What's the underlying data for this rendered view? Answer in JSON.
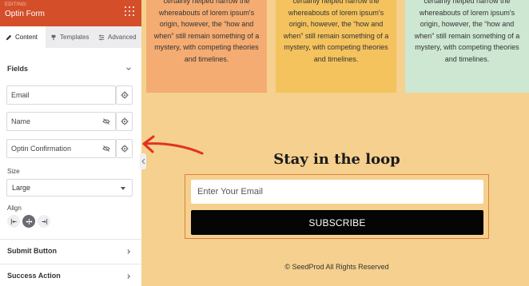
{
  "sidebar": {
    "editing_label": "EDITING:",
    "title": "Optin Form",
    "tabs": [
      {
        "label": "Content",
        "icon": "pencil-icon",
        "active": true
      },
      {
        "label": "Templates",
        "icon": "brush-icon",
        "active": false
      },
      {
        "label": "Advanced",
        "icon": "sliders-icon",
        "active": false
      }
    ],
    "fields_heading": "Fields",
    "fields": [
      {
        "label": "Email"
      },
      {
        "label": "Name"
      },
      {
        "label": "Optin Confirmation"
      }
    ],
    "size_label": "Size",
    "size_value": "Large",
    "align_label": "Align",
    "align_selected": "center",
    "sections": [
      "Submit Button",
      "Success Action"
    ]
  },
  "preview": {
    "card_text": "certainly helped narrow the whereabouts of lorem ipsum's origin, however, the “how and when” still remain something of a mystery, with competing theories and timelines.",
    "card_colors": [
      "#f4ac72",
      "#f4c35e",
      "#cde7d2"
    ],
    "heading": "Stay in the loop",
    "email_placeholder": "Enter Your Email",
    "subscribe_label": "SUBSCRIBE",
    "footer": "© SeedProd All Rights Reserved",
    "accent_color": "#d44e2a"
  }
}
